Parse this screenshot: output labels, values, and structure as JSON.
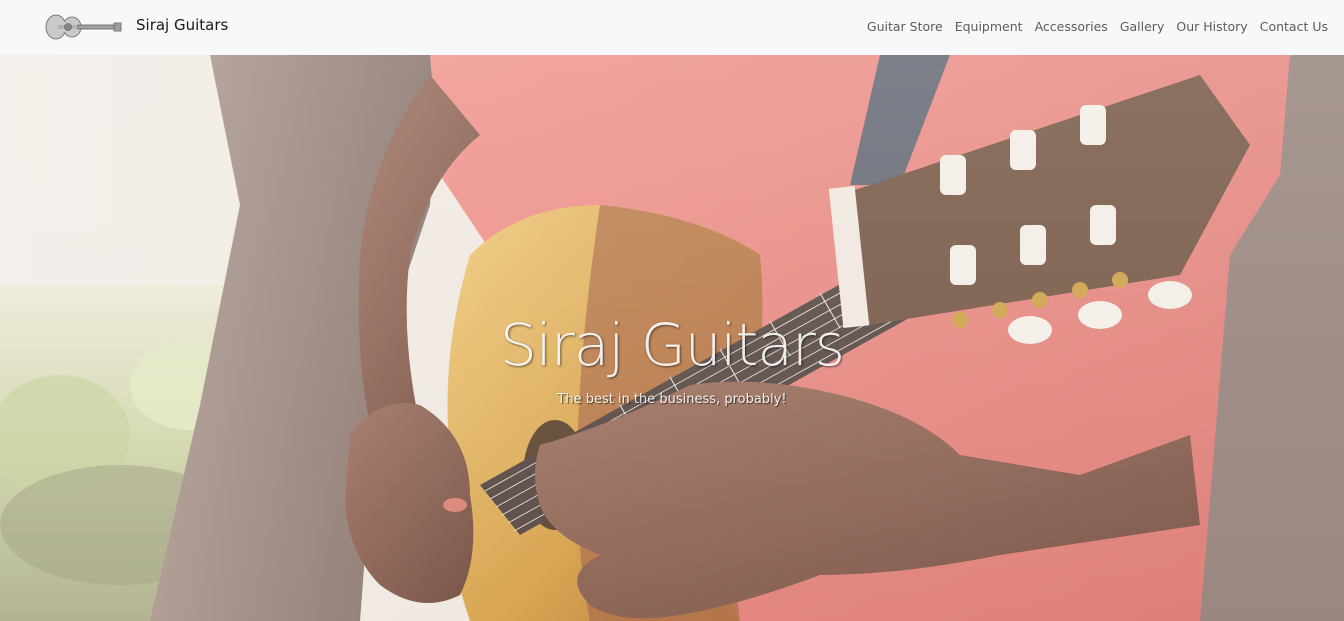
{
  "brand": {
    "name": "Siraj Guitars",
    "logo_icon": "guitar-logo-icon"
  },
  "nav": {
    "items": [
      {
        "label": "Guitar Store"
      },
      {
        "label": "Equipment"
      },
      {
        "label": "Accessories"
      },
      {
        "label": "Gallery"
      },
      {
        "label": "Our History"
      },
      {
        "label": "Contact Us"
      }
    ]
  },
  "hero": {
    "title": "Siraj Guitars",
    "subtitle": "The best in the business, probably!",
    "image": "guitarist-playing-acoustic-guitar"
  },
  "colors": {
    "navbar_bg": "#f7f8fa",
    "shirt": "#e9847c",
    "guitar_body": "#d9a24a",
    "skin": "#7a5040",
    "tree": "#8d7468"
  }
}
